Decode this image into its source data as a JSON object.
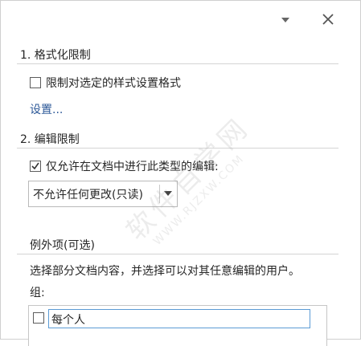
{
  "section1": {
    "title": "1. 格式化限制",
    "checkbox_label": "限制对选定的样式设置格式",
    "checkbox_checked": false,
    "settings_link": "设置..."
  },
  "section2": {
    "title": "2. 编辑限制",
    "checkbox_label": "仅允许在文档中进行此类型的编辑:",
    "checkbox_checked": true,
    "editing_type": "不允许任何更改(只读)"
  },
  "exceptions": {
    "title": "例外项(可选)",
    "description": "选择部分文档内容，并选择可以对其任意编辑的用户。",
    "group_label": "组:",
    "users": [
      {
        "name": "每个人",
        "checked": false
      }
    ]
  },
  "watermark": {
    "text": "软件自学网",
    "url": "WWW.RJZXW.COM"
  }
}
